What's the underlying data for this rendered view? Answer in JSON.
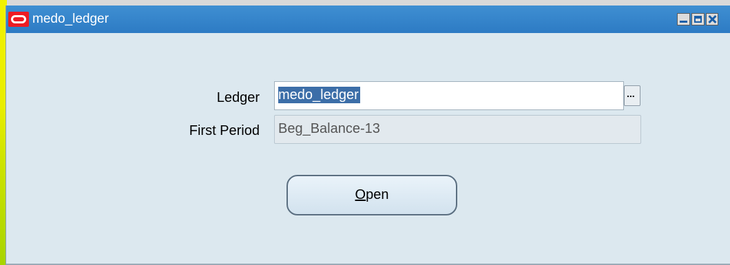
{
  "window": {
    "title": "medo_ledger",
    "controls": [
      "minimize-icon",
      "maximize-icon",
      "close-icon"
    ]
  },
  "form": {
    "ledger_label": "Ledger",
    "ledger_value": "medo_ledger",
    "ledger_lov_label": "...",
    "first_period_label": "First Period",
    "first_period_value": "Beg_Balance-13",
    "open_button": {
      "mnemonic": "O",
      "rest": "pen"
    }
  },
  "colors": {
    "titlebar": "#2d7bc4",
    "selection": "#3c6ea8",
    "window_bg": "#dce8ef"
  }
}
